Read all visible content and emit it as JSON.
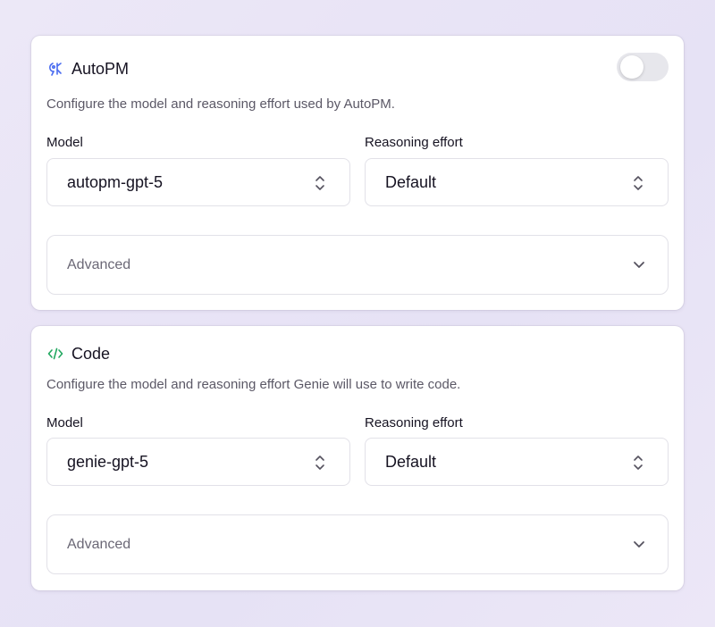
{
  "autopm": {
    "title": "AutoPM",
    "icon": "autopm-icon",
    "toggle_on": false,
    "description": "Configure the model and reasoning effort used by AutoPM.",
    "model_label": "Model",
    "model_value": "autopm-gpt-5",
    "effort_label": "Reasoning effort",
    "effort_value": "Default",
    "advanced_label": "Advanced"
  },
  "code": {
    "title": "Code",
    "icon": "code-icon",
    "description": "Configure the model and reasoning effort Genie will use to write code.",
    "model_label": "Model",
    "model_value": "genie-gpt-5",
    "effort_label": "Reasoning effort",
    "effort_value": "Default",
    "advanced_label": "Advanced"
  },
  "colors": {
    "autopm_icon": "#4a6cf0",
    "code_icon": "#22a860",
    "toggle_off": "#e7e7ec"
  }
}
